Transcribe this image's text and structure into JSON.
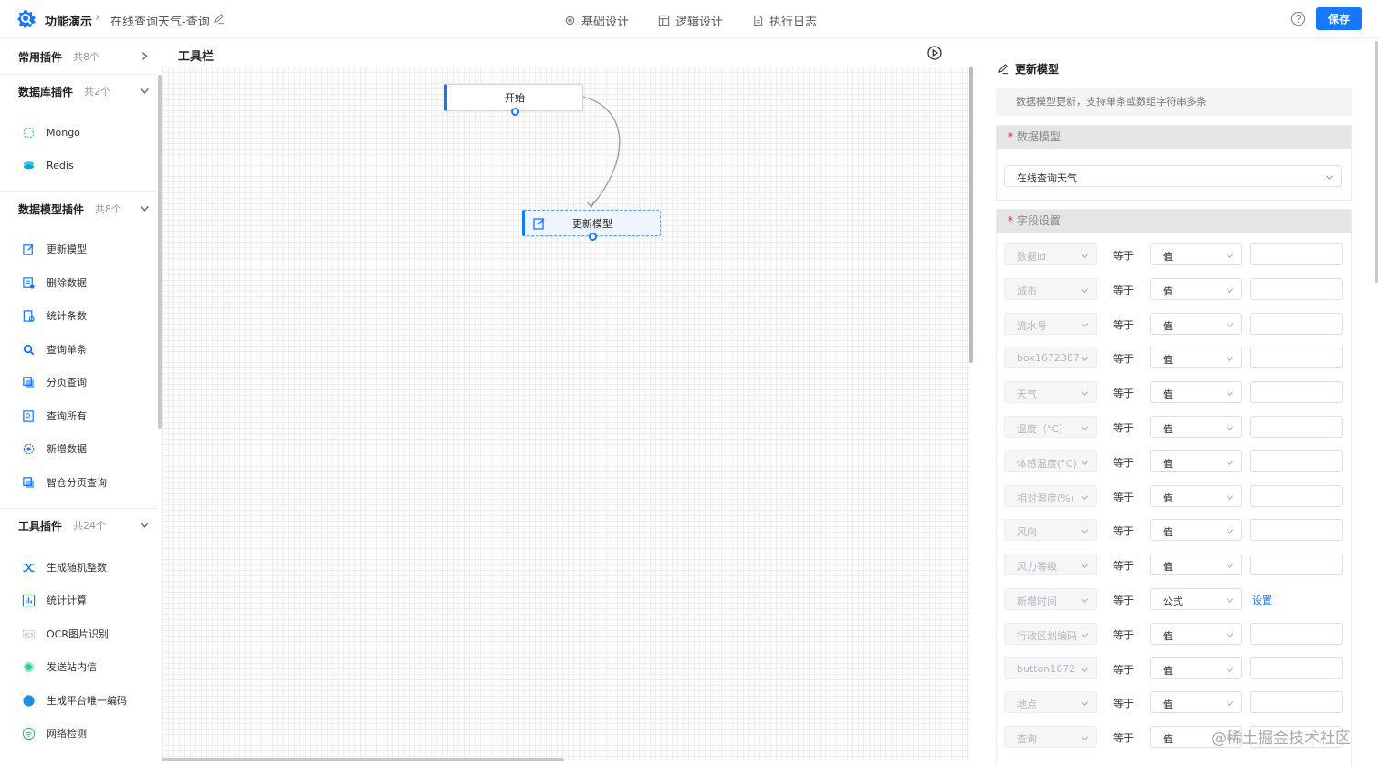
{
  "header": {
    "app_title": "功能演示",
    "breadcrumb_sep": "›",
    "page_name": "在线查询天气-查询",
    "tabs": [
      "基础设计",
      "逻辑设计",
      "执行日志"
    ],
    "save_label": "保存"
  },
  "sidebar": {
    "groups": [
      {
        "title": "常用插件",
        "count": "共8个",
        "items": []
      },
      {
        "title": "数据库插件",
        "count": "共2个",
        "items": [
          "Mongo",
          "Redis"
        ]
      },
      {
        "title": "数据模型插件",
        "count": "共8个",
        "items": [
          "更新模型",
          "删除数据",
          "统计条数",
          "查询单条",
          "分页查询",
          "查询所有",
          "新增数据",
          "智仓分页查询"
        ]
      },
      {
        "title": "工具插件",
        "count": "共24个",
        "items": [
          "生成随机整数",
          "统计计算",
          "OCR图片识别",
          "发送站内信",
          "生成平台唯一编码",
          "网络检测"
        ]
      }
    ]
  },
  "canvas": {
    "toolbar_title": "工具栏",
    "nodes": {
      "start": "开始",
      "update": "更新模型"
    }
  },
  "panel": {
    "title": "更新模型",
    "description": "数据模型更新，支持单条或数组字符串多条",
    "model_section": {
      "required_mark": "*",
      "title": "数据模型",
      "selected": "在线查询天气"
    },
    "fields_section": {
      "required_mark": "*",
      "title": "字段设置",
      "op_label": "等于",
      "rows": [
        {
          "field": "数据id",
          "mode": "值"
        },
        {
          "field": "城市",
          "mode": "值"
        },
        {
          "field": "流水号",
          "mode": "值"
        },
        {
          "field": "box1672387",
          "mode": "值"
        },
        {
          "field": "天气",
          "mode": "值"
        },
        {
          "field": "温度（°C）",
          "mode": "值"
        },
        {
          "field": "体感温度(°C)",
          "mode": "值"
        },
        {
          "field": "相对湿度(%)",
          "mode": "值"
        },
        {
          "field": "风向",
          "mode": "值"
        },
        {
          "field": "风力等级",
          "mode": "值"
        },
        {
          "field": "新增时间",
          "mode": "公式",
          "link": "设置"
        },
        {
          "field": "行政区划编码",
          "mode": "值"
        },
        {
          "field": "button1672",
          "mode": "值"
        },
        {
          "field": "地点",
          "mode": "值"
        },
        {
          "field": "查询",
          "mode": "值"
        }
      ]
    }
  },
  "watermark": "@稀土掘金技术社区"
}
